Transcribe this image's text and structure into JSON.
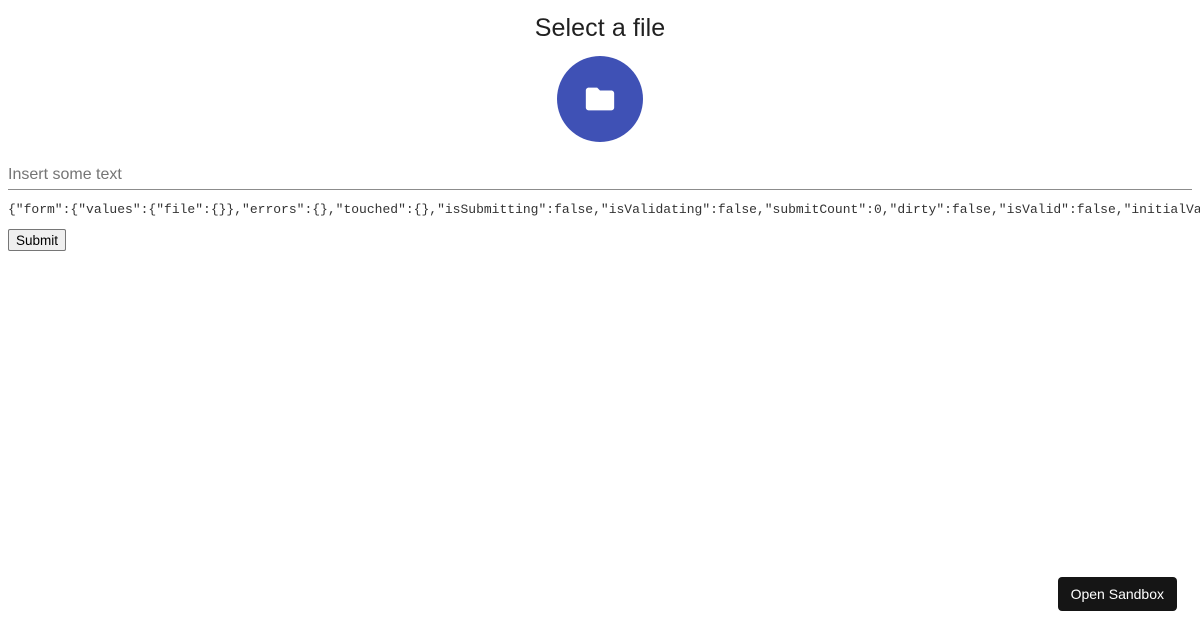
{
  "header": {
    "title": "Select a file"
  },
  "file_picker": {
    "icon": "folder-icon",
    "color": "#3f51b5"
  },
  "text_input": {
    "placeholder": "Insert some text",
    "value": ""
  },
  "form_state": {
    "text": "{\"form\":{\"values\":{\"file\":{}},\"errors\":{},\"touched\":{},\"isSubmitting\":false,\"isValidating\":false,\"submitCount\":0,\"dirty\":false,\"isValid\":false,\"initialVa"
  },
  "actions": {
    "submit_label": "Submit"
  },
  "sandbox": {
    "label": "Open Sandbox"
  }
}
